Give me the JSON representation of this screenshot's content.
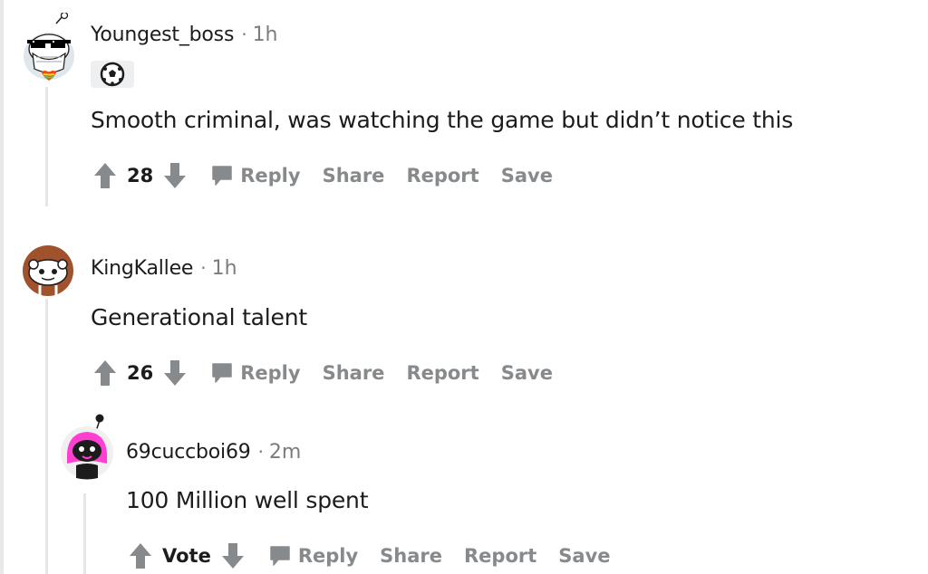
{
  "comments": [
    {
      "username": "Youngest_boss",
      "separator": "·",
      "age": "1h",
      "body": "Smooth criminal, was watching the game but didn’t notice this",
      "score": "28",
      "actions": {
        "reply": "Reply",
        "share": "Share",
        "report": "Report",
        "save": "Save"
      },
      "flair_icon": "soccer-ball-icon"
    },
    {
      "username": "KingKallee",
      "separator": "·",
      "age": "1h",
      "body": "Generational talent",
      "score": "26",
      "actions": {
        "reply": "Reply",
        "share": "Share",
        "report": "Report",
        "save": "Save"
      }
    },
    {
      "username": "69cuccboi69",
      "separator": "·",
      "age": "2m",
      "body": "100 Million well spent",
      "score": "Vote",
      "actions": {
        "reply": "Reply",
        "share": "Share",
        "report": "Report",
        "save": "Save"
      }
    }
  ],
  "icons": {
    "upvote": "arrow-up-icon",
    "downvote": "arrow-down-icon",
    "reply": "speech-bubble-icon"
  },
  "colors": {
    "text": "#1c1c1c",
    "muted": "#878a8c",
    "meta": "#7c7c7c",
    "thread_line": "#e6e6e6",
    "avatar_pink": "#ff3fd2"
  }
}
